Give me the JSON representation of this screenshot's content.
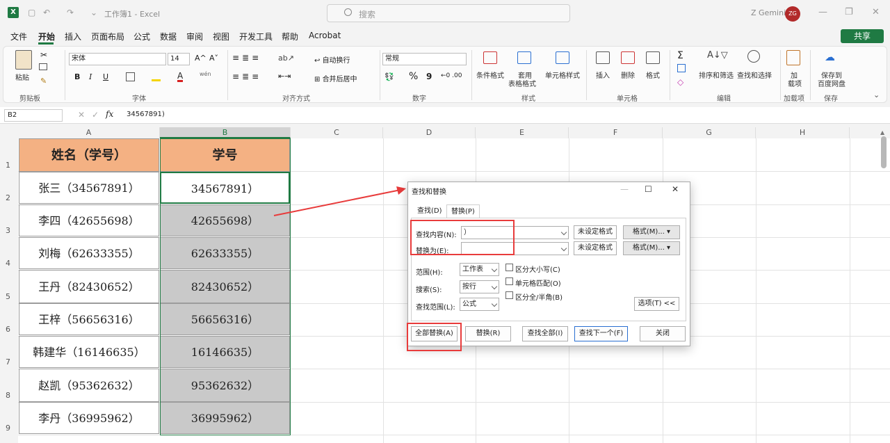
{
  "titlebar": {
    "app_icon": "X",
    "doc_title": "工作簿1 - Excel",
    "search_placeholder": "搜索",
    "user_name": "Z Gemini",
    "user_initials": "ZG"
  },
  "menu": [
    "文件",
    "开始",
    "插入",
    "页面布局",
    "公式",
    "数据",
    "审阅",
    "视图",
    "开发工具",
    "帮助",
    "Acrobat"
  ],
  "share_label": "共享",
  "ribbon": {
    "clipboard": {
      "paste": "粘贴",
      "group": "剪贴板"
    },
    "font": {
      "name": "宋体",
      "size": "14",
      "bold": "B",
      "italic": "I",
      "underline": "U",
      "grow": "A^",
      "shrink": "A˅",
      "color_a": "A",
      "wen": "wén",
      "group": "字体"
    },
    "align": {
      "wrap": "自动换行",
      "merge": "合并后居中",
      "group": "对齐方式"
    },
    "number": {
      "format": "常规",
      "percent": "%",
      "comma": "9",
      "group": "数字"
    },
    "styles": {
      "cond": "条件格式",
      "table": "套用",
      "table2": "表格格式",
      "cell": "单元格样式",
      "group": "样式"
    },
    "cells": {
      "insert": "插入",
      "delete": "删除",
      "format": "格式",
      "group": "单元格"
    },
    "edit": {
      "sort": "排序和筛选",
      "find": "查找和选择",
      "group": "编辑"
    },
    "addin": {
      "label1": "加",
      "label2": "载项",
      "group": "加载项"
    },
    "save": {
      "label1": "保存到",
      "label2": "百度网盘",
      "group": "保存"
    },
    "accent": "#1f7a43"
  },
  "formula_bar": {
    "cell_ref": "B2",
    "fx": "fx",
    "value": "34567891)"
  },
  "columns": [
    "A",
    "B",
    "C",
    "D",
    "E",
    "F",
    "G",
    "H"
  ],
  "rows": [
    "1",
    "2",
    "3",
    "4",
    "5",
    "6",
    "7",
    "8",
    "9"
  ],
  "table": {
    "header": [
      "姓名（学号）",
      "学号"
    ],
    "rows": [
      [
        "张三（34567891）",
        "34567891）"
      ],
      [
        "李四（42655698）",
        "42655698）"
      ],
      [
        "刘梅（62633355）",
        "62633355）"
      ],
      [
        "王丹（82430652）",
        "82430652）"
      ],
      [
        "王梓（56656316）",
        "56656316）"
      ],
      [
        "韩建华（16146635）",
        "16146635）"
      ],
      [
        "赵凯（95362632）",
        "95362632）"
      ],
      [
        "李丹（36995962）",
        "36995962）"
      ]
    ],
    "header_color": "#f4b183"
  },
  "dialog": {
    "title": "查找和替换",
    "tab_find": "查找(D)",
    "tab_replace": "替换(P)",
    "find_label": "查找内容(N):",
    "find_value": "）",
    "replace_label": "替换为(E):",
    "replace_value": "",
    "no_format": "未设定格式",
    "format_btn": "格式(M)...",
    "scope_label": "范围(H):",
    "scope_value": "工作表",
    "search_label": "搜索(S):",
    "search_value": "按行",
    "lookin_label": "查找范围(L):",
    "lookin_value": "公式",
    "match_case": "区分大小写(C)",
    "match_cell": "单元格匹配(O)",
    "match_width": "区分全/半角(B)",
    "options_btn": "选项(T) <<",
    "replace_all": "全部替换(A)",
    "replace": "替换(R)",
    "find_all": "查找全部(I)",
    "find_next": "查找下一个(F)",
    "close": "关闭",
    "highlight_color": "#e83b3b"
  }
}
